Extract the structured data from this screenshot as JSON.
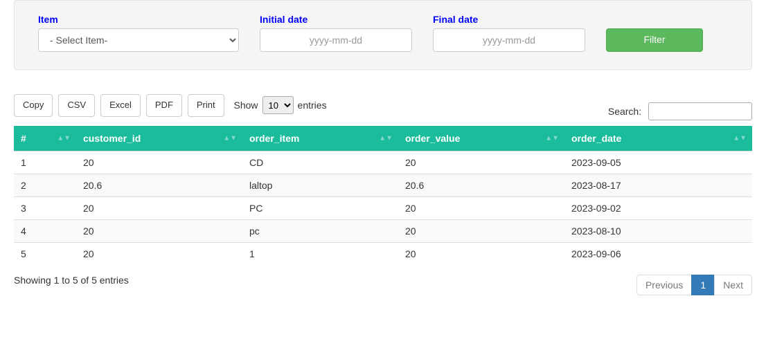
{
  "filter": {
    "item_label": "Item",
    "item_placeholder": "- Select Item-",
    "initial_label": "Initial date",
    "final_label": "Final date",
    "date_placeholder": "yyyy-mm-dd",
    "button": "Filter"
  },
  "buttons": {
    "copy": "Copy",
    "csv": "CSV",
    "excel": "Excel",
    "pdf": "PDF",
    "print": "Print"
  },
  "length": {
    "show": "Show",
    "entries": "entries",
    "value": "10"
  },
  "search": {
    "label": "Search:",
    "value": ""
  },
  "table": {
    "headers": {
      "idx": "#",
      "cust": "customer_id",
      "item": "order_item",
      "val": "order_value",
      "date": "order_date"
    },
    "rows": [
      {
        "idx": "1",
        "cust": "20",
        "item": "CD",
        "val": "20",
        "date": "2023-09-05"
      },
      {
        "idx": "2",
        "cust": "20.6",
        "item": "laltop",
        "val": "20.6",
        "date": "2023-08-17"
      },
      {
        "idx": "3",
        "cust": "20",
        "item": "PC",
        "val": "20",
        "date": "2023-09-02"
      },
      {
        "idx": "4",
        "cust": "20",
        "item": "pc",
        "val": "20",
        "date": "2023-08-10"
      },
      {
        "idx": "5",
        "cust": "20",
        "item": "1",
        "val": "20",
        "date": "2023-09-06"
      }
    ]
  },
  "info": "Showing 1 to 5 of 5 entries",
  "paginate": {
    "prev": "Previous",
    "page": "1",
    "next": "Next"
  }
}
